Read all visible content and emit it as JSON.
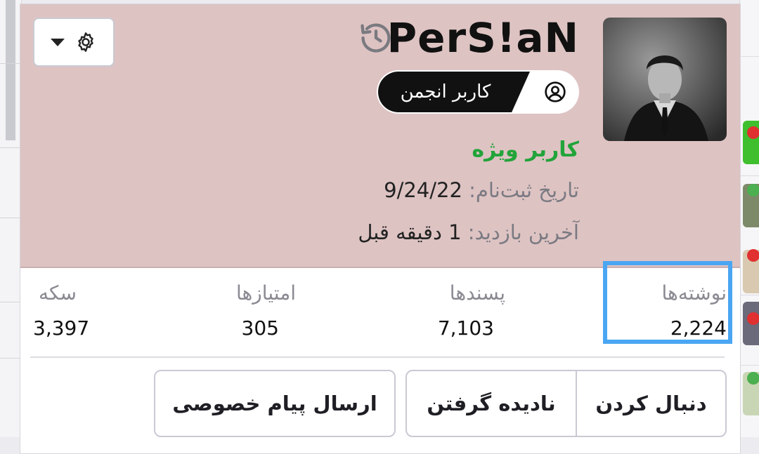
{
  "profile": {
    "username": "PerS!aN",
    "role_badge": "کاربر انجمن",
    "user_title": "کاربر ویژه",
    "registered_label": "تاریخ ثبت‌نام:",
    "registered_value": "9/24/22",
    "last_seen_label": "آخرین بازدید:",
    "last_seen_value": "1 دقیقه قبل",
    "header_color": "#dec3c3",
    "title_color": "#22a43a"
  },
  "stats": [
    {
      "label": "نوشته‌ها",
      "value": "2,224"
    },
    {
      "label": "پسندها",
      "value": "7,103"
    },
    {
      "label": "امتیازها",
      "value": "305"
    },
    {
      "label": "سکه",
      "value": "3,397"
    }
  ],
  "actions": {
    "follow": "دنبال کردن",
    "ignore": "نادیده گرفتن",
    "message": "ارسال پیام خصوصی"
  },
  "icons": {
    "settings": "gear-icon",
    "dropdown": "caret-down-icon",
    "history": "history-icon",
    "user": "user-circle-icon"
  },
  "highlight_color": "#4aa6f2"
}
